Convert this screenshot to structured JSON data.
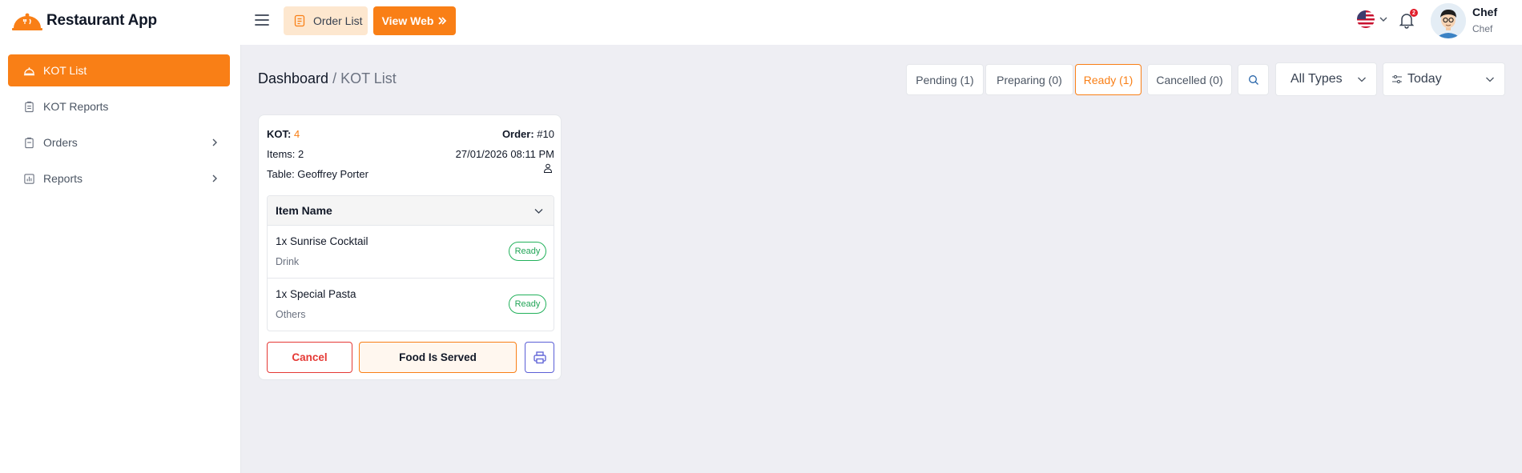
{
  "app": {
    "name": "Restaurant App"
  },
  "topbar": {
    "order_list_label": "Order List",
    "view_web_label": "View Web",
    "notification_count": "2",
    "user": {
      "name": "Chef",
      "role": "Chef"
    }
  },
  "sidebar": {
    "items": [
      {
        "label": "KOT List",
        "icon": "cloche-icon",
        "active": true
      },
      {
        "label": "KOT Reports",
        "icon": "clipboard-icon"
      },
      {
        "label": "Orders",
        "icon": "clipboard-list-icon",
        "expandable": true
      },
      {
        "label": "Reports",
        "icon": "bar-chart-icon",
        "expandable": true
      }
    ]
  },
  "breadcrumb": {
    "root": "Dashboard",
    "separator": " / ",
    "current": "KOT List"
  },
  "filters": {
    "tabs": [
      {
        "label": "Pending (1)",
        "active": false
      },
      {
        "label": "Preparing (0)",
        "active": false
      },
      {
        "label": "Ready (1)",
        "active": true
      },
      {
        "label": "Cancelled (0)",
        "active": false
      }
    ],
    "type_select": "All Types",
    "date_select": "Today"
  },
  "kot_card": {
    "kot_label": "KOT:",
    "kot_number": "4",
    "order_label": "Order:",
    "order_number": "#10",
    "items_text": "Items: 2",
    "datetime": "27/01/2026 08:11 PM",
    "table_text": "Table: Geoffrey Porter",
    "column_header": "Item Name",
    "items": [
      {
        "name": "1x Sunrise Cocktail",
        "category": "Drink",
        "status": "Ready"
      },
      {
        "name": "1x Special Pasta",
        "category": "Others",
        "status": "Ready"
      }
    ],
    "cancel_label": "Cancel",
    "served_label": "Food Is Served"
  },
  "colors": {
    "accent": "#f97f16",
    "ready": "#22b15b",
    "danger": "#e53935",
    "print": "#5b5fd6",
    "background": "#eeeef3"
  }
}
